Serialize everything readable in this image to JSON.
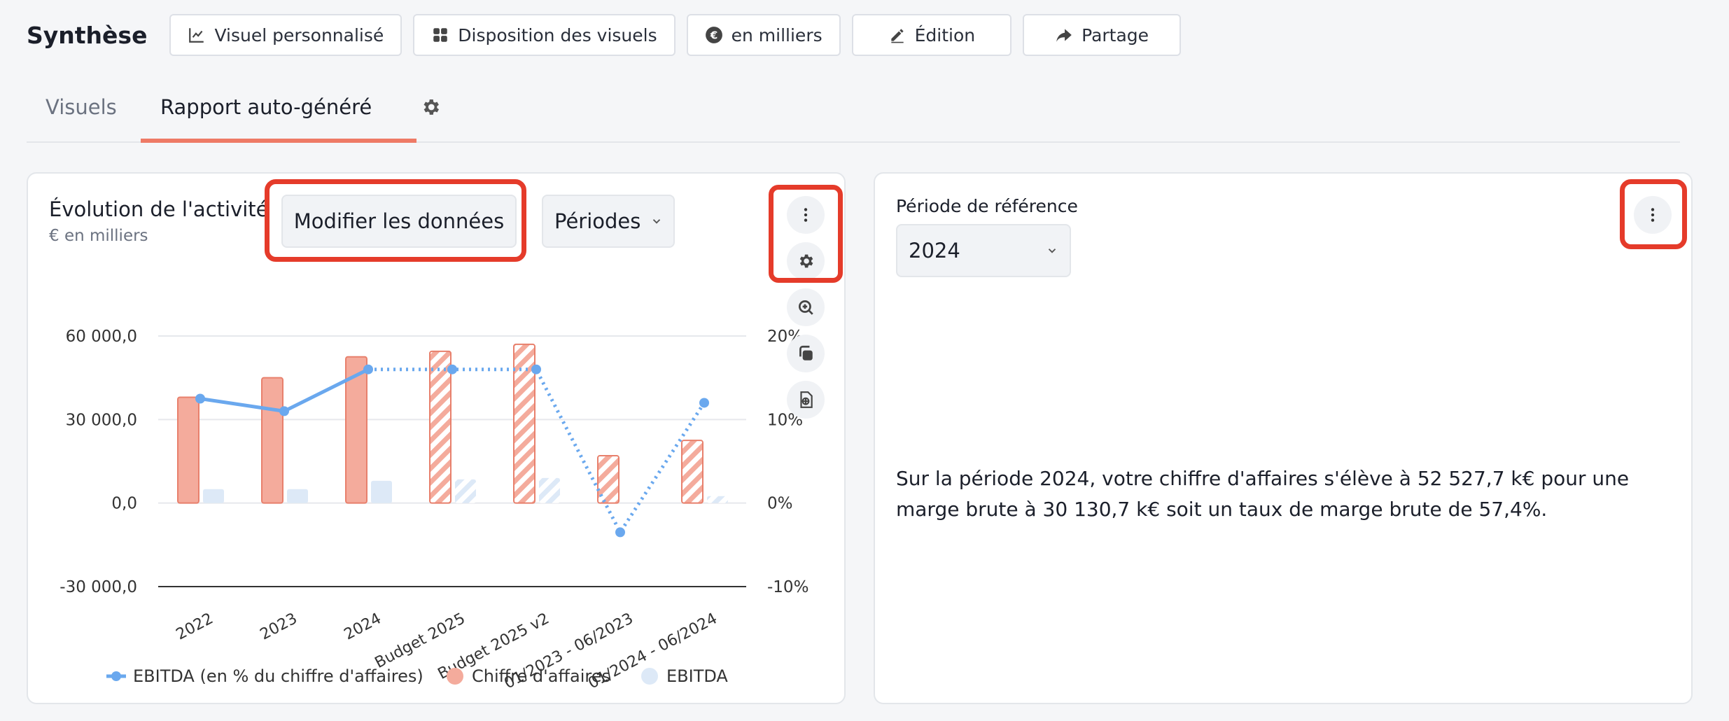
{
  "header": {
    "title": "Synthèse",
    "buttons": [
      {
        "label": "Visuel personnalisé",
        "icon": "line-chart-icon"
      },
      {
        "label": "Disposition des visuels",
        "icon": "grid-icon"
      },
      {
        "label": "en milliers",
        "icon": "euro-icon"
      },
      {
        "label": "Édition",
        "icon": "edit-icon"
      },
      {
        "label": "Partage",
        "icon": "share-icon"
      }
    ]
  },
  "tabs": {
    "items": [
      "Visuels",
      "Rapport auto-généré"
    ],
    "active": "Rapport auto-généré"
  },
  "left_card": {
    "title": "Évolution de l'activité",
    "subtitle": "€ en milliers",
    "modify_button": "Modifier les données",
    "period_select": "Périodes"
  },
  "right_card": {
    "reference_label": "Période de référence",
    "reference_value": "2024",
    "summary": "Sur la période 2024, votre chiffre d'affaires s'élève à 52 527,7 k€ pour une marge brute à 30 130,7 k€ soit un taux de marge brute de 57,4%."
  },
  "colors": {
    "accent": "#ee7a66",
    "revenue": "#f4ab9c",
    "revenue_stroke": "#e8806c",
    "ebitda": "#dde9f7",
    "line": "#6aa8ee",
    "highlight": "#e53b2a"
  },
  "chart_data": {
    "type": "bar",
    "categories": [
      "2022",
      "2023",
      "2024",
      "Budget 2025",
      "Budget 2025 v2",
      "01/2023 - 06/2023",
      "01/2024 - 06/2024"
    ],
    "series": [
      {
        "name": "EBITDA (en % du chiffre d'affaires)",
        "type": "line",
        "axis": "right",
        "values": [
          12.5,
          11.0,
          16.0,
          16.0,
          16.0,
          -3.5,
          12.0
        ]
      },
      {
        "name": "Chiffre d'affaires",
        "type": "bar",
        "values": [
          38000,
          45000,
          52527.7,
          54500,
          57000,
          17000,
          22500
        ]
      },
      {
        "name": "EBITDA",
        "type": "bar",
        "values": [
          5000,
          5000,
          8000,
          8500,
          9000,
          0,
          2500
        ]
      }
    ],
    "projected_categories": [
      "Budget 2025",
      "Budget 2025 v2",
      "01/2023 - 06/2023",
      "01/2024 - 06/2024"
    ],
    "y_ticks": [
      "60 000,0",
      "30 000,0",
      "0,0",
      "-30 000,0"
    ],
    "y2_ticks": [
      "20%",
      "10%",
      "0%",
      "-10%"
    ],
    "ylim": [
      -30000,
      60000
    ],
    "y2lim": [
      -10,
      20
    ],
    "legend_position": "bottom"
  }
}
